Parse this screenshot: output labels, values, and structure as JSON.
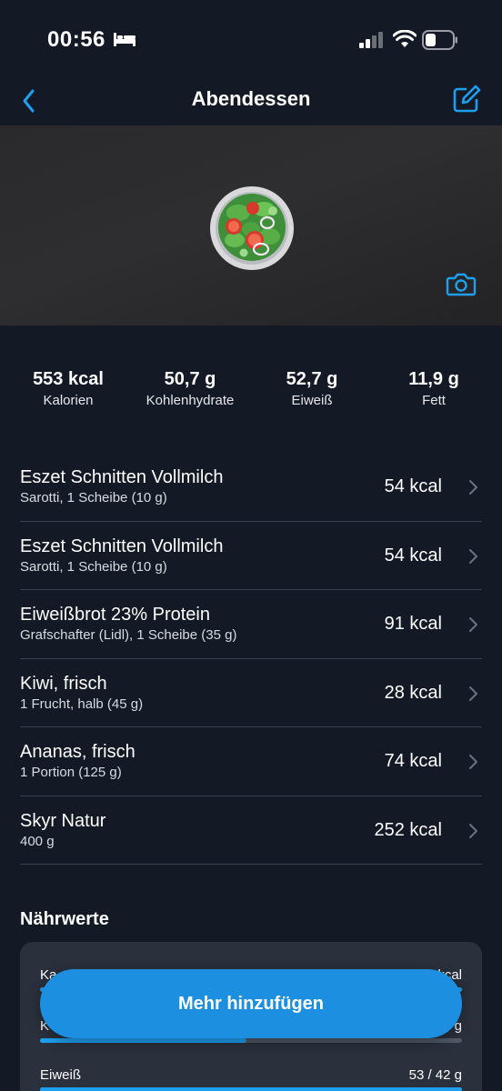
{
  "status": {
    "time": "00:56",
    "icons": [
      "bed-icon",
      "signal-icon",
      "wifi-icon",
      "battery-icon"
    ]
  },
  "nav": {
    "title": "Abendessen",
    "back_icon": "chevron-left-icon",
    "edit_icon": "edit-icon"
  },
  "hero": {
    "image_icon": "salad-icon",
    "camera_icon": "camera-icon"
  },
  "summary": [
    {
      "value": "553 kcal",
      "label": "Kalorien"
    },
    {
      "value": "50,7 g",
      "label": "Kohlenhydrate"
    },
    {
      "value": "52,7 g",
      "label": "Eiweiß"
    },
    {
      "value": "11,9 g",
      "label": "Fett"
    }
  ],
  "foods": [
    {
      "name": "Eszet Schnitten Vollmilch",
      "detail": "Sarotti, 1 Scheibe (10 g)",
      "kcal": "54 kcal"
    },
    {
      "name": "Eszet Schnitten Vollmilch",
      "detail": "Sarotti, 1 Scheibe (10 g)",
      "kcal": "54 kcal"
    },
    {
      "name": "Eiweißbrot 23% Protein",
      "detail": "Grafschafter (Lidl), 1 Scheibe (35 g)",
      "kcal": "91 kcal"
    },
    {
      "name": "Kiwi, frisch",
      "detail": "1 Frucht, halb (45 g)",
      "kcal": "28 kcal"
    },
    {
      "name": "Ananas, frisch",
      "detail": "1 Portion (125 g)",
      "kcal": "74 kcal"
    },
    {
      "name": "Skyr Natur",
      "detail": "400 g",
      "kcal": "252 kcal"
    }
  ],
  "nutrition": {
    "title": "Nährwerte",
    "rows": [
      {
        "label": "Ka",
        "value": "kcal",
        "fill": 1.0
      },
      {
        "label": "K",
        "value": "g",
        "fill": 0.49
      },
      {
        "label": "Eiweiß",
        "value": "53 / 42 g",
        "fill": 1.0
      }
    ]
  },
  "actions": {
    "add_more": "Mehr hinzufügen"
  },
  "colors": {
    "background": "#131a26",
    "accent": "#1ea0f0",
    "card": "#2a303c",
    "button": "#1d8fe0"
  }
}
